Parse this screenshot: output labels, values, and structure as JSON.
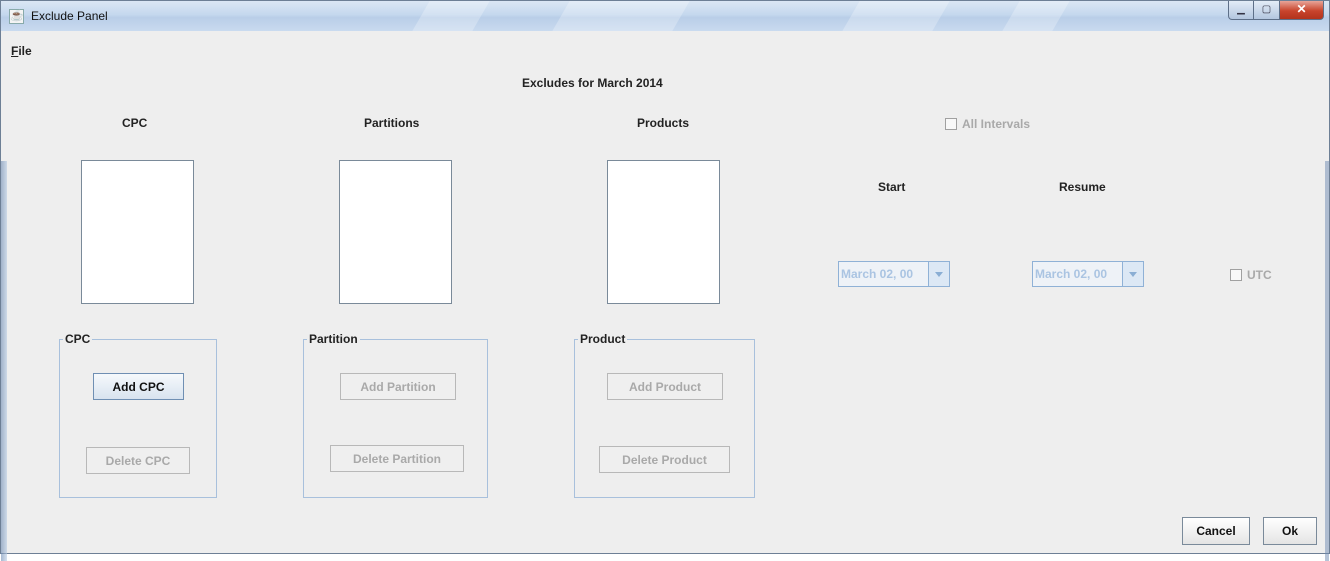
{
  "window": {
    "title": "Exclude Panel",
    "app_icon": "java-coffee-icon"
  },
  "menu": {
    "file_first": "F",
    "file_rest": "ile"
  },
  "header": {
    "title": "Excludes for March 2014"
  },
  "columns": {
    "cpc": "CPC",
    "partitions": "Partitions",
    "products": "Products"
  },
  "all_intervals_label": "All Intervals",
  "start_label": "Start",
  "resume_label": "Resume",
  "start_combo": {
    "value": "March 02, 00"
  },
  "resume_combo": {
    "value": "March 02, 00"
  },
  "utc_label": "UTC",
  "groups": {
    "cpc": {
      "title": "CPC",
      "add": "Add CPC",
      "delete": "Delete CPC"
    },
    "partition": {
      "title": "Partition",
      "add": "Add Partition",
      "delete": "Delete Partition"
    },
    "product": {
      "title": "Product",
      "add": "Add Product",
      "delete": "Delete Product"
    }
  },
  "footer": {
    "cancel": "Cancel",
    "ok": "Ok"
  }
}
